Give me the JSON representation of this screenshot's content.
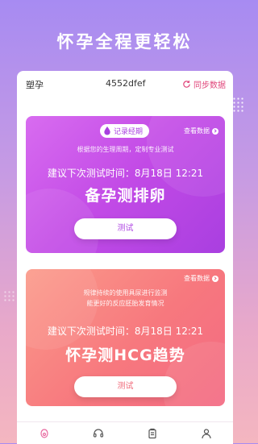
{
  "headline": "怀孕全程更轻松",
  "panel": {
    "left_label": "塑孕",
    "id": "4552dfef",
    "sync_label": "同步数据"
  },
  "cards": [
    {
      "record_label": "记录经期",
      "view_label": "查看数据",
      "desc": "根据您的生理周期，定制专业测试",
      "next_prefix": "建议下次测试时间：",
      "next_time": "8月18日 12:21",
      "title": "备孕测排卵",
      "button": "测试"
    },
    {
      "view_label": "查看数据",
      "desc_line1": "规律持续的使用具尿进行监测",
      "desc_line2": "能更好的反应胚胎发育情况",
      "next_prefix": "建议下次测试时间：",
      "next_time": "8月18日 12:21",
      "title": "怀孕测HCG趋势",
      "button": "测试"
    }
  ],
  "tabbar": {
    "items": [
      {
        "icon": "home-icon",
        "active": true
      },
      {
        "icon": "headset-icon",
        "active": false
      },
      {
        "icon": "clipboard-icon",
        "active": false
      },
      {
        "icon": "profile-icon",
        "active": false
      }
    ]
  },
  "colors": {
    "accent": "#e0457a",
    "card1": "#c24ae6",
    "card2": "#f7787e"
  }
}
